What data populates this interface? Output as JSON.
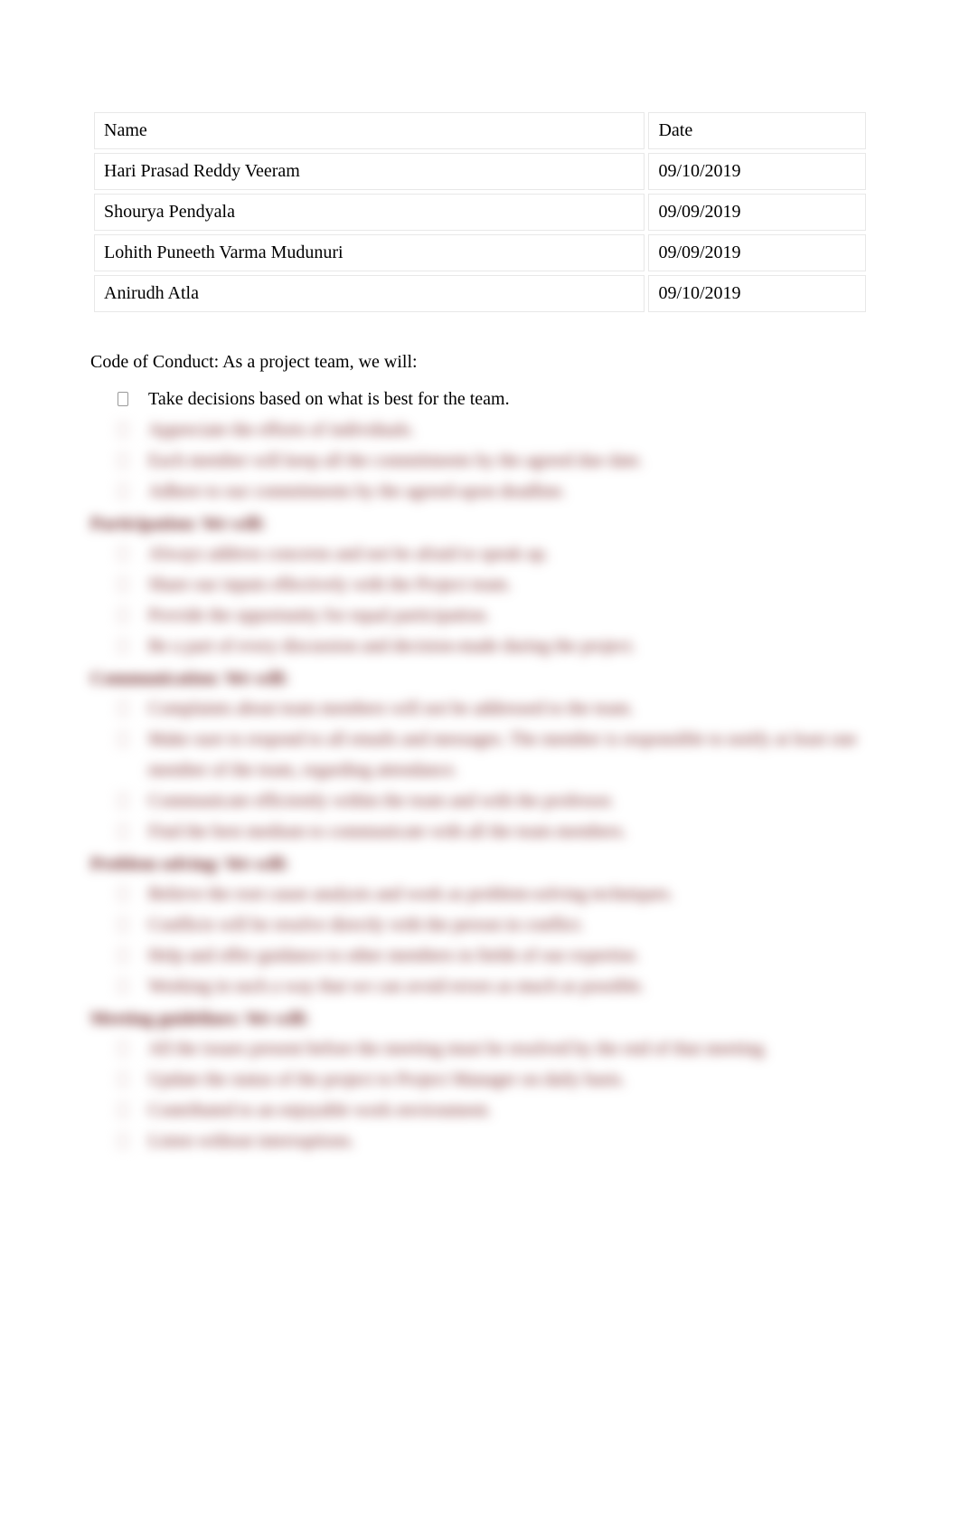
{
  "table": {
    "headers": {
      "name": "Name",
      "date": "Date"
    },
    "rows": [
      {
        "name": "Hari Prasad Reddy Veeram",
        "date": "09/10/2019"
      },
      {
        "name": "Shourya Pendyala",
        "date": "09/09/2019"
      },
      {
        "name": "Lohith Puneeth Varma Mudunuri",
        "date": "09/09/2019"
      },
      {
        "name": "Anirudh Atla",
        "date": "09/10/2019"
      }
    ]
  },
  "intro": "Code of Conduct:  As a project team, we will:",
  "first_bullet": "Take decisions based on what is best for the team.",
  "blurred_sections": [
    {
      "head": "",
      "items": [
        "Appreciate the efforts of individuals.",
        "Each member will keep all the commitments by the agreed due date.",
        "Adhere to our commitments by the agreed-upon deadline."
      ]
    },
    {
      "head": "Participation: We will:",
      "items": [
        "Always address concerns and not be afraid to speak up.",
        "Share our inputs effectively with the Project team.",
        "Provide the opportunity for equal participation.",
        "Be a part of every discussion and decision-made during the project."
      ]
    },
    {
      "head": "Communication: We will:",
      "items": [
        "Complaints about team members will not be addressed to the team.",
        "Make sure to respond to all emails and messages. The member is responsible to notify at least one member of the team, regarding attendance.",
        "Communicate efficiently within the team and with the professor.",
        "Find the best medium to communicate with all the team members."
      ]
    },
    {
      "head": "Problem solving: We will:",
      "items": [
        "Believe the root cause analysis and work as problem-solving techniques.",
        "Conflicts will be resolve directly with the person in conflict.",
        "Help and offer guidance to other members in fields of our expertise.",
        "Working in such a way that we can avoid errors as much as possible."
      ]
    },
    {
      "head": "Meeting guidelines: We will:",
      "items": [
        "All the issues present before the meeting must be resolved by the end of that meeting.",
        "Update the status of the project to Project Manager on daily basis.",
        "Contributed to an enjoyable work environment.",
        "Listen without interruptions."
      ]
    }
  ]
}
